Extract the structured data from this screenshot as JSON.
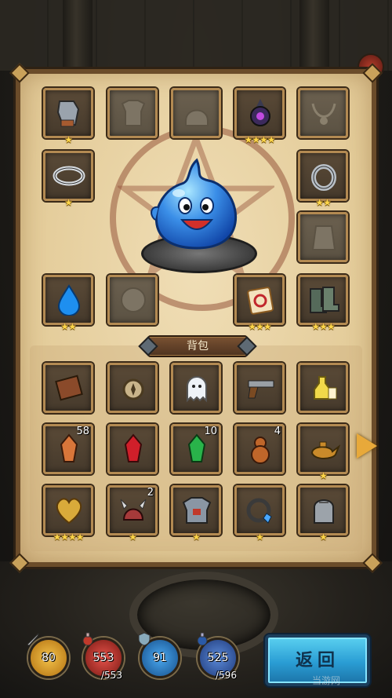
{
  "colors": {
    "panel_parchment": "#e9d4a6",
    "panel_border": "#6b4c2a",
    "slot_frame": "#b38a52",
    "star": "#ffd64a",
    "attack_orb": "#e9a21a",
    "hp_orb": "#c0342a",
    "defense_orb": "#1f7fd0",
    "mp_orb": "#2a5aa8",
    "return_button": "#2a9dd4"
  },
  "equipment": [
    {
      "icon": "gauntlet-icon",
      "stars": "★",
      "empty": false
    },
    {
      "icon": "armor-silhouette-icon",
      "stars": "",
      "empty": true
    },
    {
      "icon": "helmet-silhouette-icon",
      "stars": "",
      "empty": true
    },
    {
      "icon": "dark-orb-icon",
      "stars": "★★★★",
      "empty": false
    },
    {
      "icon": "necklace-silhouette-icon",
      "stars": "",
      "empty": true
    },
    {
      "icon": "silver-ring-icon",
      "stars": "★",
      "empty": false
    },
    {
      "icon": "ring-icon",
      "stars": "★★",
      "empty": false
    },
    {
      "icon": "cloak-silhouette-icon",
      "stars": "",
      "empty": true
    },
    {
      "icon": "water-drop-icon",
      "stars": "★★",
      "empty": false
    },
    {
      "icon": "mask-silhouette-icon",
      "stars": "",
      "empty": true
    },
    {
      "icon": "mahjong-tile-icon",
      "stars": "★★★",
      "empty": false
    },
    {
      "icon": "boots-icon",
      "stars": "★★★",
      "empty": false
    }
  ],
  "character": {
    "icon": "blue-slime-icon"
  },
  "bag": {
    "label": "背包",
    "items": [
      {
        "icon": "book-icon",
        "count": "",
        "stars": ""
      },
      {
        "icon": "compass-icon",
        "count": "",
        "stars": ""
      },
      {
        "icon": "ghost-icon",
        "count": "",
        "stars": ""
      },
      {
        "icon": "pistol-icon",
        "count": "",
        "stars": ""
      },
      {
        "icon": "potion-bottles-icon",
        "count": "",
        "stars": ""
      },
      {
        "icon": "orange-crystal-icon",
        "count": "58",
        "stars": ""
      },
      {
        "icon": "red-crystal-icon",
        "count": "",
        "stars": ""
      },
      {
        "icon": "green-crystal-icon",
        "count": "10",
        "stars": ""
      },
      {
        "icon": "gourd-icon",
        "count": "4",
        "stars": ""
      },
      {
        "icon": "magic-lamp-icon",
        "count": "",
        "stars": "★"
      },
      {
        "icon": "golden-heart-icon",
        "count": "",
        "stars": "★★★★"
      },
      {
        "icon": "horned-helmet-icon",
        "count": "2",
        "stars": "★"
      },
      {
        "icon": "chest-armor-icon",
        "count": "",
        "stars": "★"
      },
      {
        "icon": "gem-ring-icon",
        "count": "",
        "stars": "★"
      },
      {
        "icon": "chainmail-icon",
        "count": "",
        "stars": "★"
      }
    ]
  },
  "stats": {
    "attack": {
      "value": "80",
      "icon": "sword-icon"
    },
    "hp": {
      "value": "553",
      "max": "/553",
      "icon": "potion-icon"
    },
    "defense": {
      "value": "91",
      "icon": "shield-icon"
    },
    "mp": {
      "value": "525",
      "max": "/596",
      "icon": "mana-potion-icon"
    }
  },
  "buttons": {
    "return_label": "返回"
  },
  "watermark": "当游网"
}
